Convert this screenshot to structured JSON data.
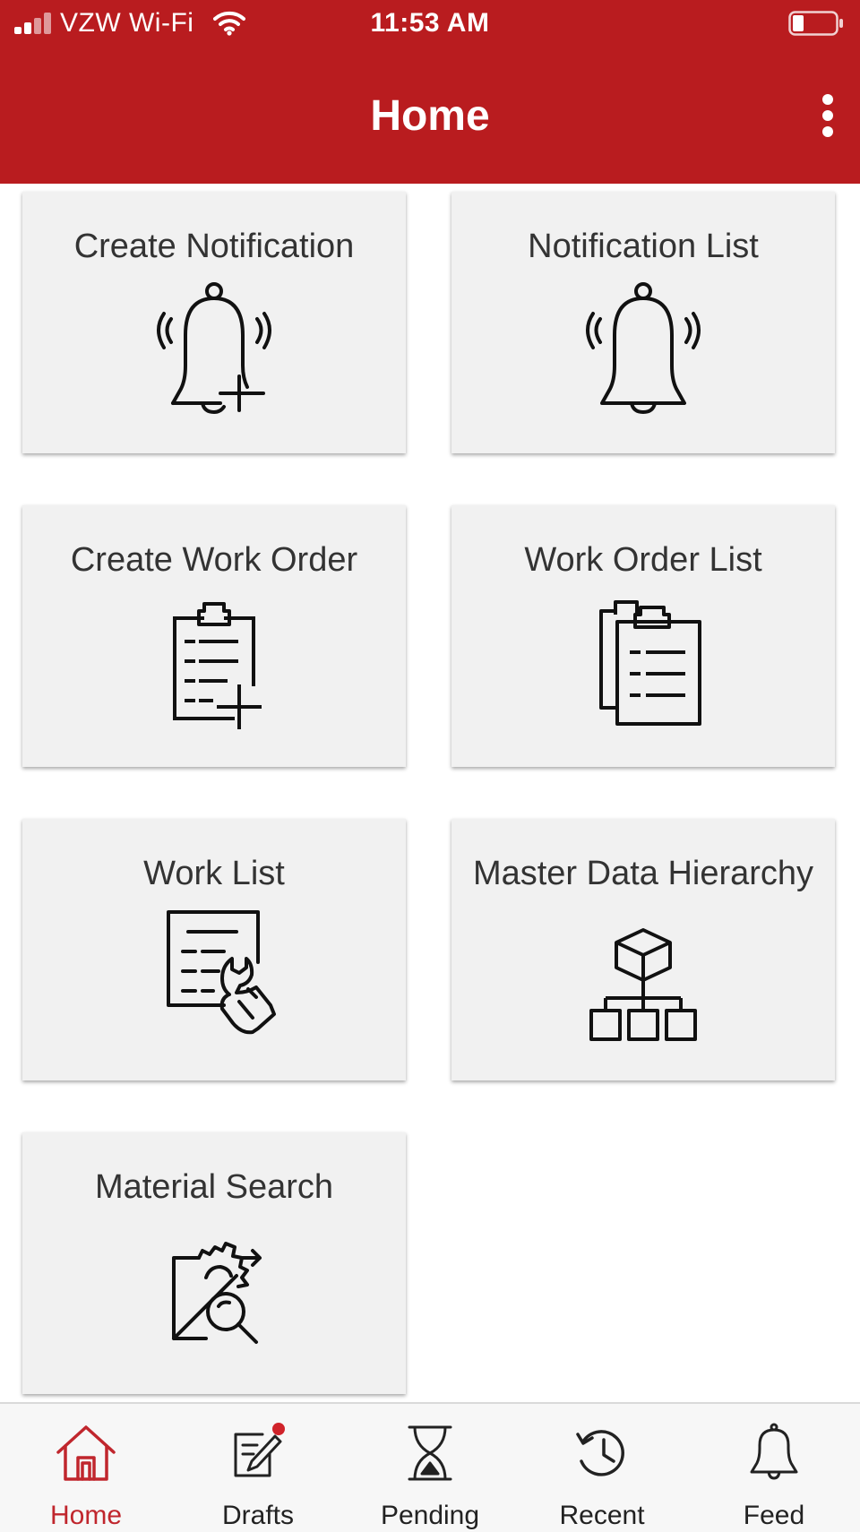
{
  "status_bar": {
    "carrier": "VZW Wi-Fi",
    "time": "11:53 AM",
    "signal_icon": "signal-bars-icon",
    "wifi_icon": "wifi-icon",
    "battery_icon": "battery-icon"
  },
  "header": {
    "title": "Home",
    "menu_icon": "more-vertical-icon"
  },
  "tiles": [
    {
      "label": "Create Notification",
      "icon": "bell-plus-icon"
    },
    {
      "label": "Notification List",
      "icon": "bell-ringing-icon"
    },
    {
      "label": "Create Work Order",
      "icon": "clipboard-plus-icon"
    },
    {
      "label": "Work Order List",
      "icon": "clipboards-icon"
    },
    {
      "label": "Work List",
      "icon": "document-wrench-icon"
    },
    {
      "label": "Master Data Hierarchy",
      "icon": "hierarchy-icon"
    },
    {
      "label": "Material Search",
      "icon": "material-search-icon"
    }
  ],
  "tabbar": {
    "items": [
      {
        "label": "Home",
        "icon": "home-icon",
        "active": true
      },
      {
        "label": "Drafts",
        "icon": "drafts-icon",
        "badge": true
      },
      {
        "label": "Pending",
        "icon": "hourglass-icon"
      },
      {
        "label": "Recent",
        "icon": "history-icon"
      },
      {
        "label": "Feed",
        "icon": "bell-icon"
      }
    ]
  },
  "colors": {
    "brand": "#b91c1f",
    "tile_background": "#f1f1f1",
    "active_tab": "#c0262d",
    "badge": "#d0232a"
  }
}
